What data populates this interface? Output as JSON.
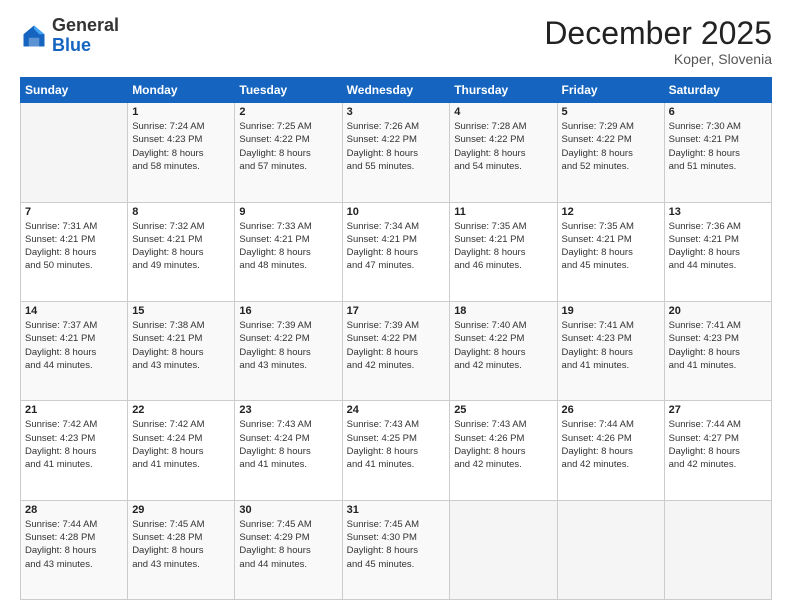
{
  "header": {
    "logo_general": "General",
    "logo_blue": "Blue",
    "month_title": "December 2025",
    "location": "Koper, Slovenia"
  },
  "weekdays": [
    "Sunday",
    "Monday",
    "Tuesday",
    "Wednesday",
    "Thursday",
    "Friday",
    "Saturday"
  ],
  "weeks": [
    [
      {
        "day": "",
        "info": ""
      },
      {
        "day": "1",
        "info": "Sunrise: 7:24 AM\nSunset: 4:23 PM\nDaylight: 8 hours\nand 58 minutes."
      },
      {
        "day": "2",
        "info": "Sunrise: 7:25 AM\nSunset: 4:22 PM\nDaylight: 8 hours\nand 57 minutes."
      },
      {
        "day": "3",
        "info": "Sunrise: 7:26 AM\nSunset: 4:22 PM\nDaylight: 8 hours\nand 55 minutes."
      },
      {
        "day": "4",
        "info": "Sunrise: 7:28 AM\nSunset: 4:22 PM\nDaylight: 8 hours\nand 54 minutes."
      },
      {
        "day": "5",
        "info": "Sunrise: 7:29 AM\nSunset: 4:22 PM\nDaylight: 8 hours\nand 52 minutes."
      },
      {
        "day": "6",
        "info": "Sunrise: 7:30 AM\nSunset: 4:21 PM\nDaylight: 8 hours\nand 51 minutes."
      }
    ],
    [
      {
        "day": "7",
        "info": "Sunrise: 7:31 AM\nSunset: 4:21 PM\nDaylight: 8 hours\nand 50 minutes."
      },
      {
        "day": "8",
        "info": "Sunrise: 7:32 AM\nSunset: 4:21 PM\nDaylight: 8 hours\nand 49 minutes."
      },
      {
        "day": "9",
        "info": "Sunrise: 7:33 AM\nSunset: 4:21 PM\nDaylight: 8 hours\nand 48 minutes."
      },
      {
        "day": "10",
        "info": "Sunrise: 7:34 AM\nSunset: 4:21 PM\nDaylight: 8 hours\nand 47 minutes."
      },
      {
        "day": "11",
        "info": "Sunrise: 7:35 AM\nSunset: 4:21 PM\nDaylight: 8 hours\nand 46 minutes."
      },
      {
        "day": "12",
        "info": "Sunrise: 7:35 AM\nSunset: 4:21 PM\nDaylight: 8 hours\nand 45 minutes."
      },
      {
        "day": "13",
        "info": "Sunrise: 7:36 AM\nSunset: 4:21 PM\nDaylight: 8 hours\nand 44 minutes."
      }
    ],
    [
      {
        "day": "14",
        "info": "Sunrise: 7:37 AM\nSunset: 4:21 PM\nDaylight: 8 hours\nand 44 minutes."
      },
      {
        "day": "15",
        "info": "Sunrise: 7:38 AM\nSunset: 4:21 PM\nDaylight: 8 hours\nand 43 minutes."
      },
      {
        "day": "16",
        "info": "Sunrise: 7:39 AM\nSunset: 4:22 PM\nDaylight: 8 hours\nand 43 minutes."
      },
      {
        "day": "17",
        "info": "Sunrise: 7:39 AM\nSunset: 4:22 PM\nDaylight: 8 hours\nand 42 minutes."
      },
      {
        "day": "18",
        "info": "Sunrise: 7:40 AM\nSunset: 4:22 PM\nDaylight: 8 hours\nand 42 minutes."
      },
      {
        "day": "19",
        "info": "Sunrise: 7:41 AM\nSunset: 4:23 PM\nDaylight: 8 hours\nand 41 minutes."
      },
      {
        "day": "20",
        "info": "Sunrise: 7:41 AM\nSunset: 4:23 PM\nDaylight: 8 hours\nand 41 minutes."
      }
    ],
    [
      {
        "day": "21",
        "info": "Sunrise: 7:42 AM\nSunset: 4:23 PM\nDaylight: 8 hours\nand 41 minutes."
      },
      {
        "day": "22",
        "info": "Sunrise: 7:42 AM\nSunset: 4:24 PM\nDaylight: 8 hours\nand 41 minutes."
      },
      {
        "day": "23",
        "info": "Sunrise: 7:43 AM\nSunset: 4:24 PM\nDaylight: 8 hours\nand 41 minutes."
      },
      {
        "day": "24",
        "info": "Sunrise: 7:43 AM\nSunset: 4:25 PM\nDaylight: 8 hours\nand 41 minutes."
      },
      {
        "day": "25",
        "info": "Sunrise: 7:43 AM\nSunset: 4:26 PM\nDaylight: 8 hours\nand 42 minutes."
      },
      {
        "day": "26",
        "info": "Sunrise: 7:44 AM\nSunset: 4:26 PM\nDaylight: 8 hours\nand 42 minutes."
      },
      {
        "day": "27",
        "info": "Sunrise: 7:44 AM\nSunset: 4:27 PM\nDaylight: 8 hours\nand 42 minutes."
      }
    ],
    [
      {
        "day": "28",
        "info": "Sunrise: 7:44 AM\nSunset: 4:28 PM\nDaylight: 8 hours\nand 43 minutes."
      },
      {
        "day": "29",
        "info": "Sunrise: 7:45 AM\nSunset: 4:28 PM\nDaylight: 8 hours\nand 43 minutes."
      },
      {
        "day": "30",
        "info": "Sunrise: 7:45 AM\nSunset: 4:29 PM\nDaylight: 8 hours\nand 44 minutes."
      },
      {
        "day": "31",
        "info": "Sunrise: 7:45 AM\nSunset: 4:30 PM\nDaylight: 8 hours\nand 45 minutes."
      },
      {
        "day": "",
        "info": ""
      },
      {
        "day": "",
        "info": ""
      },
      {
        "day": "",
        "info": ""
      }
    ]
  ]
}
